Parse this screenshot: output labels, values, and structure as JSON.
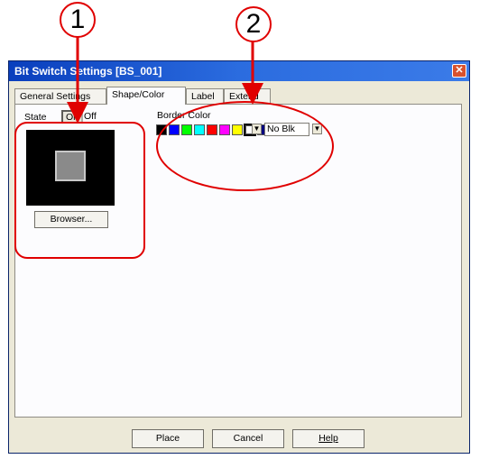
{
  "annotations": {
    "marker1": "1",
    "marker2": "2",
    "color": "#e00000"
  },
  "window": {
    "title": "Bit Switch Settings [BS_001]",
    "close_glyph": "✕"
  },
  "tabs": [
    {
      "label": "General Settings",
      "active": false
    },
    {
      "label": "Shape/Color",
      "active": true
    },
    {
      "label": "Label",
      "active": false
    },
    {
      "label": "Extend",
      "active": false
    }
  ],
  "state": {
    "label": "State",
    "on": "On",
    "off": "Off",
    "selected": "On",
    "browser_label": "Browser..."
  },
  "border_color": {
    "label": "Border Color",
    "swatches": [
      "#000000",
      "#0000ff",
      "#00ff00",
      "#00ffff",
      "#ff0000",
      "#ff00ff",
      "#ffff00",
      "#ffffff",
      "#000080"
    ],
    "selected_swatch": "#ffffff",
    "blink_value": "No Blk",
    "dropdown_glyph": "▼"
  },
  "footer": {
    "place": "Place",
    "cancel": "Cancel",
    "help": "Help"
  }
}
